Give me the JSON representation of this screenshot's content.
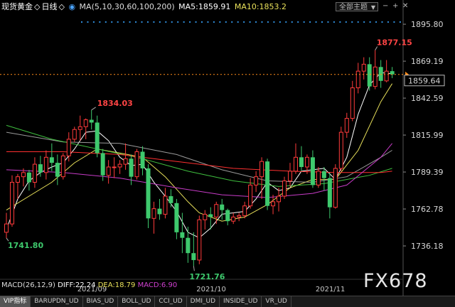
{
  "header": {
    "symbol": "现货黄金",
    "period": "日线",
    "ma_params": "MA(5,10,30,60,100,200)",
    "ma5": "MA5:1859.91",
    "ma10": "MA10:1853.2",
    "theme_label": "全部主题",
    "colors": {
      "symbol": "#ffffff",
      "period": "#ffffff",
      "ma_params": "#dddddd",
      "ma5": "#ffffff",
      "ma10": "#e8e05a"
    }
  },
  "macd_bar": {
    "params": "MACD(26,12,9)",
    "diff": "DIFF:22.24",
    "dea": "DEA:18.79",
    "macd": "MACD:6.90"
  },
  "tabs": [
    "VIP指标",
    "BARUPDN_UD",
    "BIAS_UD",
    "BOLL_UD",
    "CCI_UD",
    "DMI_UD",
    "INSIDE_UD",
    "VR_UD"
  ],
  "watermark": "FX678",
  "current_price_tag": "1859.64",
  "chart_data": {
    "type": "candlestick",
    "y_ticks": [
      1895.8,
      1869.19,
      1842.59,
      1815.99,
      1789.39,
      1762.78,
      1736.18
    ],
    "ylim": [
      1709.6,
      1903.0
    ],
    "x_ticks": [
      "2021/09",
      "2021/10",
      "2021/11"
    ],
    "x_tick_index": [
      15,
      36,
      57
    ],
    "annotations": [
      {
        "text": "1877.15",
        "index": 65,
        "value": 1877.15,
        "color": "#ff4444"
      },
      {
        "text": "1834.03",
        "index": 15,
        "value": 1834.03,
        "color": "#ff4444"
      },
      {
        "text": "1741.80",
        "index": 0,
        "value": 1741.8,
        "color": "#3ec96d"
      },
      {
        "text": "1721.76",
        "index": 33,
        "value": 1721.76,
        "color": "#3ec96d"
      }
    ],
    "current_price": 1859.64,
    "up_color": "#ff3b3b",
    "down_color": "#3ec96d",
    "candles": [
      {
        "o": 1746,
        "h": 1760,
        "c": 1752,
        "l": 1741.8
      },
      {
        "o": 1752,
        "h": 1787,
        "c": 1782,
        "l": 1750
      },
      {
        "o": 1782,
        "h": 1788,
        "c": 1786,
        "l": 1770
      },
      {
        "o": 1786,
        "h": 1792,
        "c": 1789,
        "l": 1779
      },
      {
        "o": 1789,
        "h": 1791,
        "c": 1782,
        "l": 1776
      },
      {
        "o": 1782,
        "h": 1800,
        "c": 1795,
        "l": 1778
      },
      {
        "o": 1795,
        "h": 1801,
        "c": 1789,
        "l": 1786
      },
      {
        "o": 1789,
        "h": 1805,
        "c": 1800,
        "l": 1784
      },
      {
        "o": 1800,
        "h": 1810,
        "c": 1796,
        "l": 1790
      },
      {
        "o": 1796,
        "h": 1802,
        "c": 1786,
        "l": 1780
      },
      {
        "o": 1786,
        "h": 1803,
        "c": 1801,
        "l": 1784
      },
      {
        "o": 1801,
        "h": 1818,
        "c": 1813,
        "l": 1797
      },
      {
        "o": 1813,
        "h": 1822,
        "c": 1820,
        "l": 1811
      },
      {
        "o": 1820,
        "h": 1830,
        "c": 1822,
        "l": 1812
      },
      {
        "o": 1822,
        "h": 1828,
        "c": 1827,
        "l": 1813
      },
      {
        "o": 1827,
        "h": 1834.03,
        "c": 1825,
        "l": 1820
      },
      {
        "o": 1825,
        "h": 1830,
        "c": 1803,
        "l": 1800
      },
      {
        "o": 1803,
        "h": 1806,
        "c": 1787,
        "l": 1783
      },
      {
        "o": 1787,
        "h": 1798,
        "c": 1793,
        "l": 1781
      },
      {
        "o": 1793,
        "h": 1800,
        "c": 1793,
        "l": 1785
      },
      {
        "o": 1793,
        "h": 1798,
        "c": 1795,
        "l": 1788
      },
      {
        "o": 1795,
        "h": 1810,
        "c": 1799,
        "l": 1791
      },
      {
        "o": 1799,
        "h": 1802,
        "c": 1786,
        "l": 1780
      },
      {
        "o": 1786,
        "h": 1806,
        "c": 1804,
        "l": 1784
      },
      {
        "o": 1804,
        "h": 1808,
        "c": 1792,
        "l": 1787
      },
      {
        "o": 1792,
        "h": 1795,
        "c": 1756,
        "l": 1749
      },
      {
        "o": 1756,
        "h": 1768,
        "c": 1763,
        "l": 1745
      },
      {
        "o": 1763,
        "h": 1770,
        "c": 1759,
        "l": 1755
      },
      {
        "o": 1759,
        "h": 1778,
        "c": 1772,
        "l": 1756
      },
      {
        "o": 1772,
        "h": 1777,
        "c": 1767,
        "l": 1764
      },
      {
        "o": 1767,
        "h": 1770,
        "c": 1746,
        "l": 1741
      },
      {
        "o": 1746,
        "h": 1760,
        "c": 1742,
        "l": 1731
      },
      {
        "o": 1742,
        "h": 1750,
        "c": 1731,
        "l": 1724
      },
      {
        "o": 1731,
        "h": 1746,
        "c": 1726,
        "l": 1721.76
      },
      {
        "o": 1726,
        "h": 1758,
        "c": 1755,
        "l": 1723
      },
      {
        "o": 1755,
        "h": 1762,
        "c": 1759,
        "l": 1748
      },
      {
        "o": 1759,
        "h": 1764,
        "c": 1757,
        "l": 1748
      },
      {
        "o": 1757,
        "h": 1768,
        "c": 1766,
        "l": 1752
      },
      {
        "o": 1766,
        "h": 1770,
        "c": 1762,
        "l": 1755
      },
      {
        "o": 1762,
        "h": 1763,
        "c": 1754,
        "l": 1751
      },
      {
        "o": 1754,
        "h": 1760,
        "c": 1757,
        "l": 1752
      },
      {
        "o": 1757,
        "h": 1760,
        "c": 1758,
        "l": 1754
      },
      {
        "o": 1758,
        "h": 1768,
        "c": 1765,
        "l": 1756
      },
      {
        "o": 1765,
        "h": 1785,
        "c": 1780,
        "l": 1763
      },
      {
        "o": 1780,
        "h": 1790,
        "c": 1786,
        "l": 1775
      },
      {
        "o": 1786,
        "h": 1800,
        "c": 1797,
        "l": 1770
      },
      {
        "o": 1797,
        "h": 1799,
        "c": 1765,
        "l": 1762
      },
      {
        "o": 1765,
        "h": 1773,
        "c": 1768,
        "l": 1759
      },
      {
        "o": 1768,
        "h": 1778,
        "c": 1772,
        "l": 1761
      },
      {
        "o": 1772,
        "h": 1786,
        "c": 1783,
        "l": 1770
      },
      {
        "o": 1783,
        "h": 1796,
        "c": 1790,
        "l": 1779
      },
      {
        "o": 1790,
        "h": 1810,
        "c": 1800,
        "l": 1788
      },
      {
        "o": 1800,
        "h": 1808,
        "c": 1793,
        "l": 1790
      },
      {
        "o": 1793,
        "h": 1802,
        "c": 1800,
        "l": 1788
      },
      {
        "o": 1800,
        "h": 1805,
        "c": 1780,
        "l": 1778
      },
      {
        "o": 1780,
        "h": 1793,
        "c": 1790,
        "l": 1778
      },
      {
        "o": 1790,
        "h": 1793,
        "c": 1785,
        "l": 1776
      },
      {
        "o": 1785,
        "h": 1789,
        "c": 1764,
        "l": 1756
      },
      {
        "o": 1764,
        "h": 1795,
        "c": 1792,
        "l": 1763
      },
      {
        "o": 1792,
        "h": 1822,
        "c": 1818,
        "l": 1790
      },
      {
        "o": 1818,
        "h": 1832,
        "c": 1828,
        "l": 1814
      },
      {
        "o": 1828,
        "h": 1855,
        "c": 1850,
        "l": 1826
      },
      {
        "o": 1850,
        "h": 1868,
        "c": 1862,
        "l": 1846
      },
      {
        "o": 1862,
        "h": 1872,
        "c": 1867,
        "l": 1856
      },
      {
        "o": 1867,
        "h": 1872,
        "c": 1851,
        "l": 1848
      },
      {
        "o": 1851,
        "h": 1877.15,
        "c": 1865,
        "l": 1849
      },
      {
        "o": 1865,
        "h": 1870,
        "c": 1855,
        "l": 1850
      },
      {
        "o": 1855,
        "h": 1870,
        "c": 1862,
        "l": 1854
      },
      {
        "o": 1862,
        "h": 1865,
        "c": 1859.64,
        "l": 1857
      }
    ],
    "moving_averages": [
      {
        "name": "MA5",
        "color": "#ffffff",
        "values": [
          [
            0,
            1748
          ],
          [
            2,
            1770
          ],
          [
            4,
            1783
          ],
          [
            6,
            1789
          ],
          [
            8,
            1793
          ],
          [
            10,
            1796
          ],
          [
            12,
            1806
          ],
          [
            14,
            1818
          ],
          [
            16,
            1819
          ],
          [
            18,
            1812
          ],
          [
            20,
            1800
          ],
          [
            22,
            1794
          ],
          [
            24,
            1795
          ],
          [
            26,
            1782
          ],
          [
            28,
            1772
          ],
          [
            30,
            1761
          ],
          [
            32,
            1746
          ],
          [
            34,
            1742
          ],
          [
            36,
            1749
          ],
          [
            38,
            1759
          ],
          [
            40,
            1760
          ],
          [
            42,
            1761
          ],
          [
            44,
            1770
          ],
          [
            46,
            1782
          ],
          [
            48,
            1776
          ],
          [
            50,
            1778
          ],
          [
            52,
            1790
          ],
          [
            54,
            1791
          ],
          [
            56,
            1792
          ],
          [
            58,
            1784
          ],
          [
            60,
            1800
          ],
          [
            62,
            1831
          ],
          [
            64,
            1852
          ],
          [
            66,
            1861
          ],
          [
            68,
            1860
          ]
        ]
      },
      {
        "name": "MA10",
        "color": "#e8e05a",
        "values": [
          [
            0,
            1762
          ],
          [
            4,
            1772
          ],
          [
            8,
            1782
          ],
          [
            12,
            1796
          ],
          [
            16,
            1806
          ],
          [
            20,
            1803
          ],
          [
            24,
            1800
          ],
          [
            28,
            1786
          ],
          [
            32,
            1768
          ],
          [
            34,
            1760
          ],
          [
            38,
            1754
          ],
          [
            42,
            1757
          ],
          [
            46,
            1766
          ],
          [
            50,
            1778
          ],
          [
            54,
            1784
          ],
          [
            58,
            1784
          ],
          [
            62,
            1805
          ],
          [
            66,
            1840
          ],
          [
            68,
            1853
          ]
        ]
      },
      {
        "name": "MA30",
        "color": "#9a9a9a",
        "values": [
          [
            0,
            1818
          ],
          [
            10,
            1811
          ],
          [
            20,
            1810
          ],
          [
            30,
            1802
          ],
          [
            38,
            1791
          ],
          [
            46,
            1783
          ],
          [
            54,
            1782
          ],
          [
            60,
            1786
          ],
          [
            66,
            1800
          ],
          [
            68,
            1805
          ]
        ]
      },
      {
        "name": "MA60",
        "color": "#3fbf3f",
        "values": [
          [
            0,
            1823
          ],
          [
            8,
            1813
          ],
          [
            16,
            1806
          ],
          [
            24,
            1799
          ],
          [
            32,
            1790
          ],
          [
            40,
            1783
          ],
          [
            48,
            1779
          ],
          [
            56,
            1781
          ],
          [
            64,
            1787
          ],
          [
            68,
            1792
          ]
        ]
      },
      {
        "name": "MA100",
        "color": "#ff3030",
        "values": [
          [
            0,
            1804
          ],
          [
            10,
            1804
          ],
          [
            20,
            1802
          ],
          [
            30,
            1797
          ],
          [
            40,
            1792
          ],
          [
            50,
            1790
          ],
          [
            58,
            1789
          ],
          [
            66,
            1789
          ],
          [
            68,
            1790
          ]
        ]
      },
      {
        "name": "MA200",
        "color": "#c83cc8",
        "values": [
          [
            0,
            1791
          ],
          [
            10,
            1789
          ],
          [
            20,
            1785
          ],
          [
            30,
            1778
          ],
          [
            38,
            1773
          ],
          [
            46,
            1771
          ],
          [
            54,
            1774
          ],
          [
            60,
            1780
          ],
          [
            66,
            1800
          ],
          [
            68,
            1810
          ]
        ]
      }
    ]
  }
}
